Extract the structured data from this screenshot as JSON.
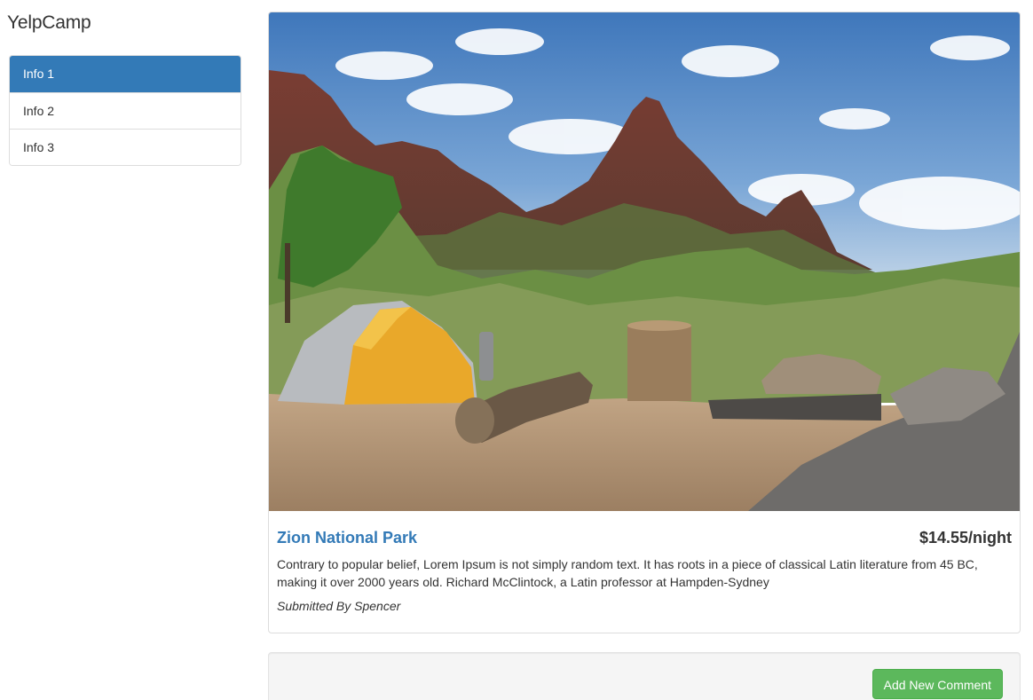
{
  "brand": "YelpCamp",
  "sidebar": {
    "items": [
      {
        "label": "Info 1",
        "active": true
      },
      {
        "label": "Info 2",
        "active": false
      },
      {
        "label": "Info 3",
        "active": false
      }
    ]
  },
  "campground": {
    "name": "Zion National Park",
    "price": "$14.55/night",
    "description": "Contrary to popular belief, Lorem Ipsum is not simply random text. It has roots in a piece of classical Latin literature from 45 BC, making it over 2000 years old. Richard McClintock, a Latin professor at Hampden-Sydney",
    "submitted_by": "Submitted By Spencer",
    "image": {
      "subject": "campsite-photo",
      "colors": {
        "sky": "#4f88c9",
        "mountain": "#8a4a3c",
        "foliage": "#5f8a3a",
        "ground": "#b59a7a",
        "tent_yellow": "#e8a92a",
        "tent_gray": "#b9bcc0"
      }
    }
  },
  "comments": {
    "add_button_label": "Add New Comment"
  },
  "colors": {
    "primary": "#337ab7",
    "success": "#5cb85c",
    "well_bg": "#f5f5f5",
    "border": "#dddddd"
  }
}
